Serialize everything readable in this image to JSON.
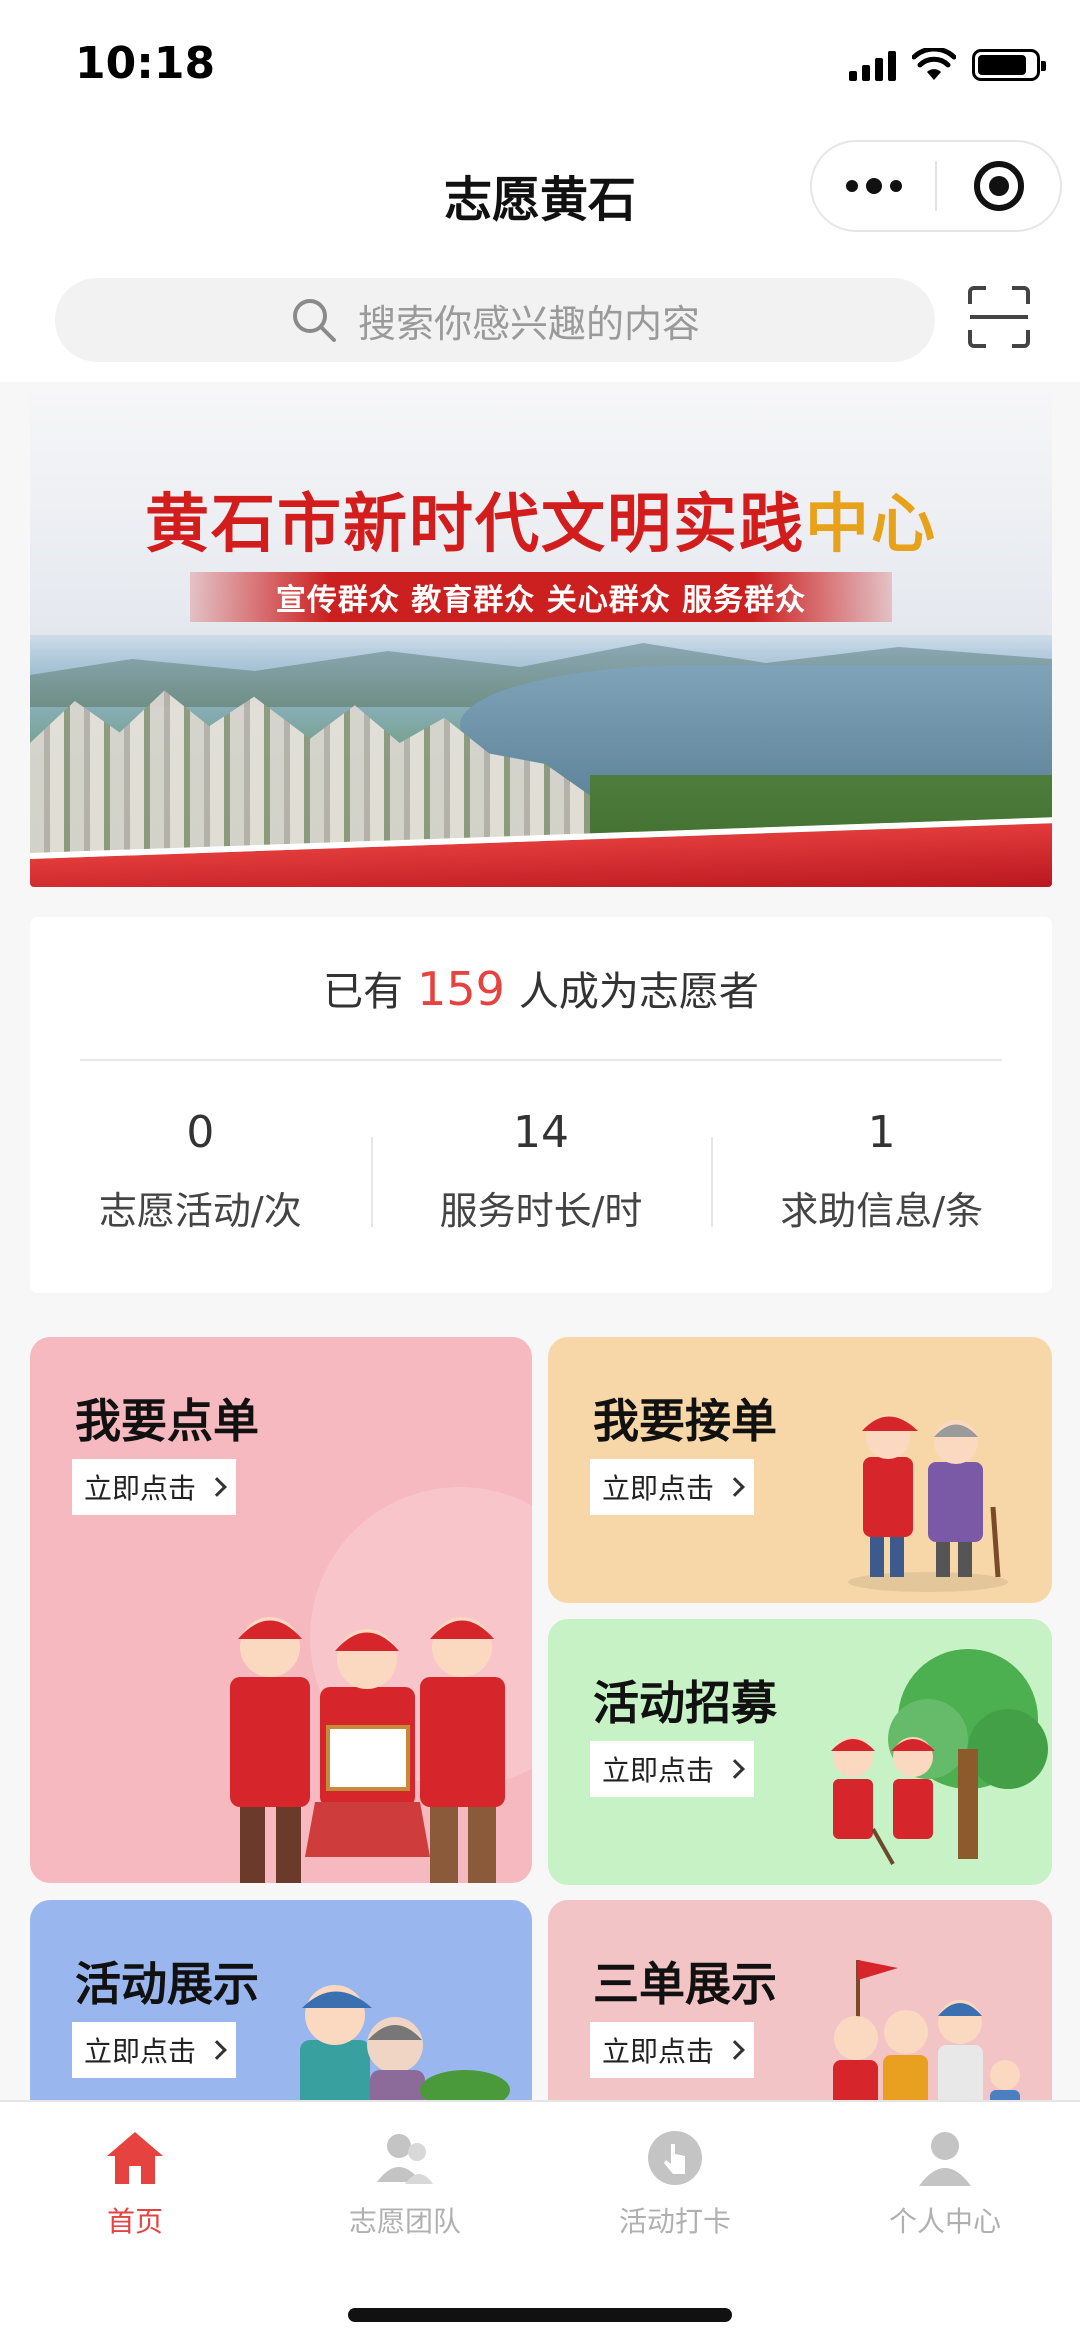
{
  "status_bar": {
    "time": "10:18"
  },
  "header": {
    "title": "志愿黄石"
  },
  "search": {
    "placeholder": "搜索你感兴趣的内容"
  },
  "banner": {
    "title_main": "黄石市新时代文明实践",
    "title_accent": "中心",
    "slogan": "宣传群众  教育群众  关心群众  服务群众"
  },
  "stats": {
    "prefix": "已有",
    "volunteer_count": "159",
    "suffix": "人成为志愿者",
    "items": [
      {
        "value": "0",
        "label": "志愿活动/次"
      },
      {
        "value": "14",
        "label": "服务时长/时"
      },
      {
        "value": "1",
        "label": "求助信息/条"
      }
    ]
  },
  "tiles": [
    {
      "title": "我要点单",
      "button": "立即点击"
    },
    {
      "title": "我要接单",
      "button": "立即点击"
    },
    {
      "title": "活动招募",
      "button": "立即点击"
    },
    {
      "title": "活动展示",
      "button": "立即点击"
    },
    {
      "title": "三单展示",
      "button": "立即点击"
    }
  ],
  "tabbar": {
    "items": [
      {
        "label": "首页",
        "icon": "home-icon",
        "active": true
      },
      {
        "label": "志愿团队",
        "icon": "team-icon",
        "active": false
      },
      {
        "label": "活动打卡",
        "icon": "tap-icon",
        "active": false
      },
      {
        "label": "个人中心",
        "icon": "person-icon",
        "active": false
      }
    ]
  },
  "colors": {
    "accent": "#e64340",
    "inactive": "#b0b0b0"
  }
}
